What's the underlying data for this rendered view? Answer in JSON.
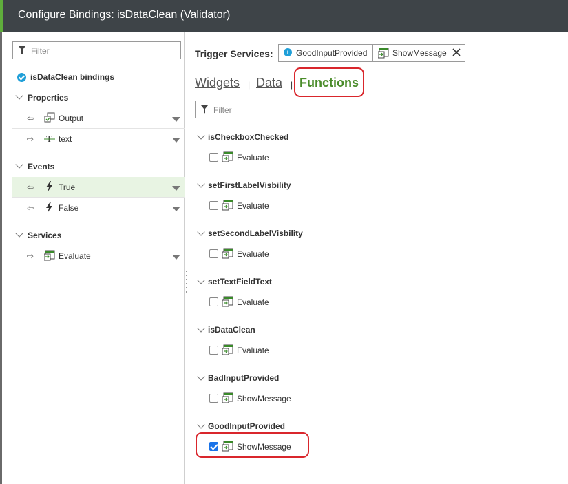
{
  "title": "Configure Bindings: isDataClean (Validator)",
  "left": {
    "filter_placeholder": "Filter",
    "bindings_title": "isDataClean bindings",
    "sections": [
      {
        "label": "Properties",
        "items": [
          {
            "label": "Output",
            "direction": "in",
            "icon": "output-icon"
          },
          {
            "label": "text",
            "direction": "out",
            "icon": "text-type-icon"
          }
        ]
      },
      {
        "label": "Events",
        "items": [
          {
            "label": "True",
            "direction": "in",
            "icon": "lightning-icon",
            "selected": true
          },
          {
            "label": "False",
            "direction": "in",
            "icon": "lightning-icon"
          }
        ]
      },
      {
        "label": "Services",
        "items": [
          {
            "label": "Evaluate",
            "direction": "out",
            "icon": "service-icon"
          }
        ]
      }
    ]
  },
  "right": {
    "trigger_label": "Trigger Services:",
    "trigger_chips": [
      "GoodInputProvided",
      "ShowMessage"
    ],
    "tabs": [
      "Widgets",
      "Data",
      "Functions"
    ],
    "tab_separator": "|",
    "active_tab": "Functions",
    "filter_placeholder": "Filter",
    "functions": [
      {
        "name": "isCheckboxChecked",
        "service": "Evaluate",
        "checked": false
      },
      {
        "name": "setFirstLabelVisbility",
        "service": "Evaluate",
        "checked": false
      },
      {
        "name": "setSecondLabelVisbility",
        "service": "Evaluate",
        "checked": false
      },
      {
        "name": "setTextFieldText",
        "service": "Evaluate",
        "checked": false
      },
      {
        "name": "isDataClean",
        "service": "Evaluate",
        "checked": false
      },
      {
        "name": "BadInputProvided",
        "service": "ShowMessage",
        "checked": false
      },
      {
        "name": "GoodInputProvided",
        "service": "ShowMessage",
        "checked": true
      }
    ]
  },
  "colors": {
    "accent_green": "#4a8c2a",
    "highlight_red": "#d9262c",
    "info_blue": "#1f9fd8",
    "titlebar": "#3e4448"
  }
}
